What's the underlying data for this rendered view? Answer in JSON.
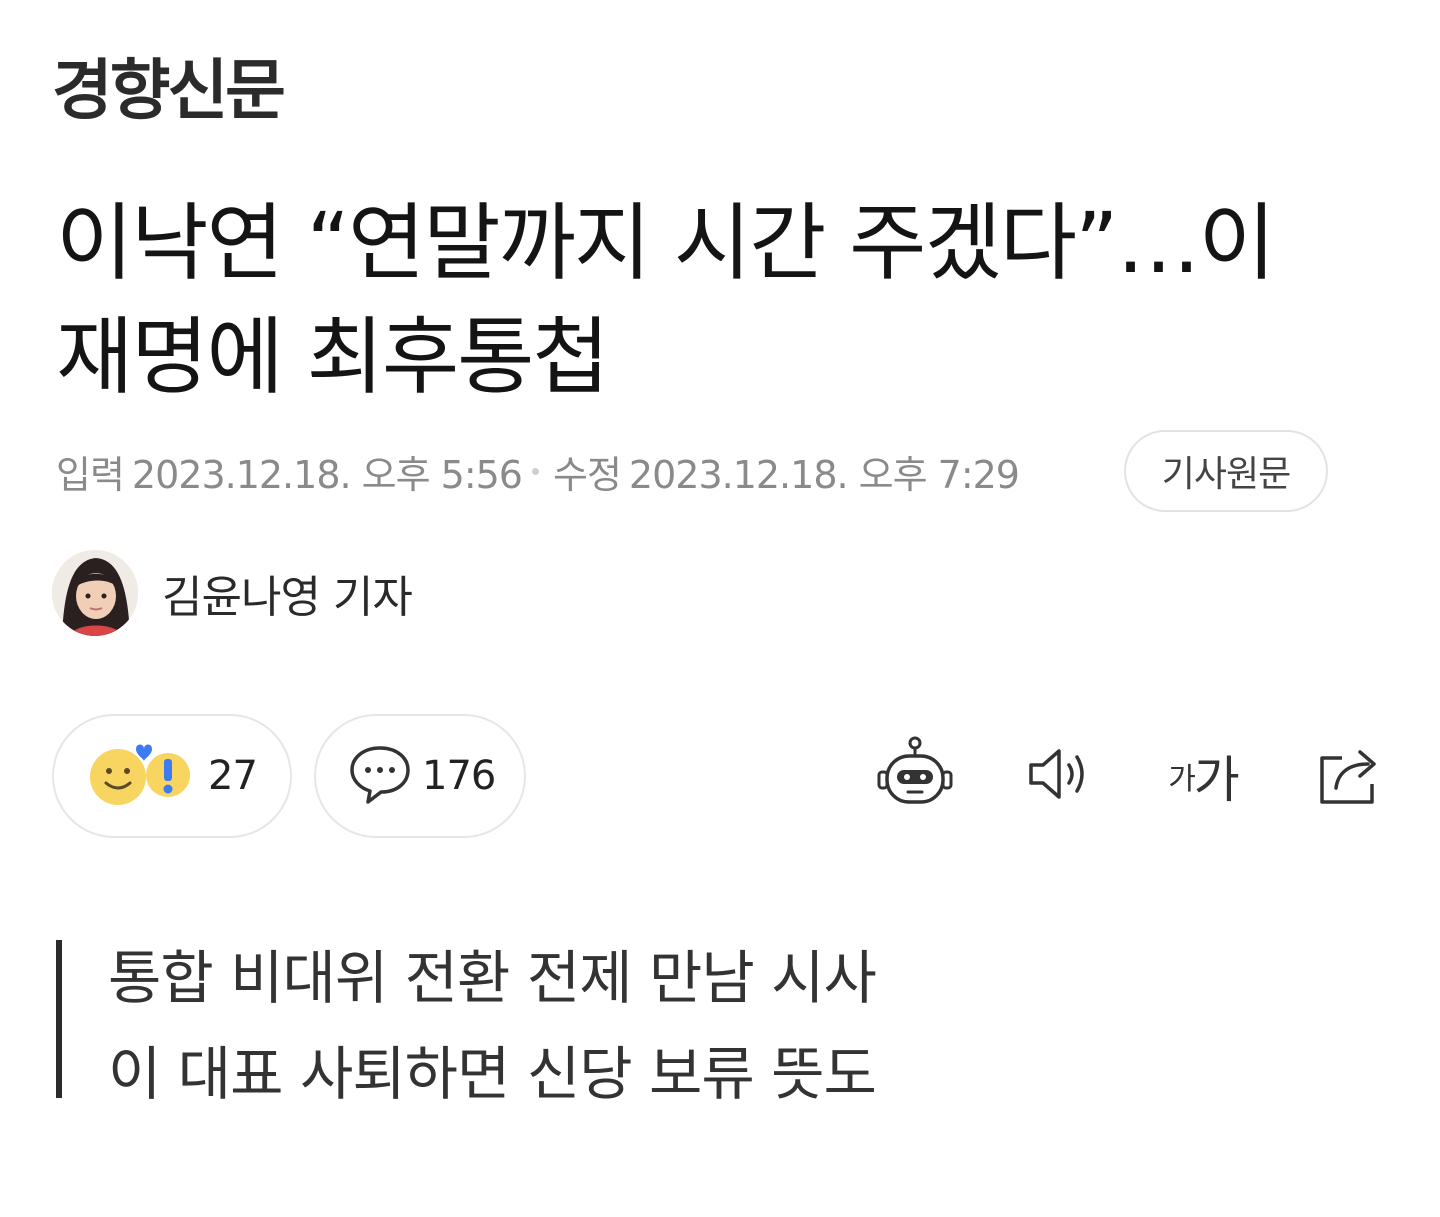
{
  "publisher": {
    "name": "경향신문"
  },
  "headline": {
    "line1": "이낙연 “연말까지 시간 주겠다”…이",
    "line2": "재명에 최후통첩"
  },
  "meta": {
    "published_label": "입력",
    "published": "2023.12.18. 오후 5:56",
    "modified_label": "수정",
    "modified": "2023.12.18. 오후 7:29",
    "original_button": "기사원문"
  },
  "author": {
    "name": "김윤나영 기자"
  },
  "reactions": {
    "count": "27",
    "icon": "emotion-emoji-icon"
  },
  "comments": {
    "count": "176",
    "icon": "comment-bubble-icon"
  },
  "tools": {
    "summary_bot_icon": "robot-icon",
    "tts_icon": "speaker-icon",
    "font_size_small": "가",
    "font_size_large": "가",
    "share_icon": "share-icon"
  },
  "summary": {
    "line1": "통합 비대위 전환 전제 만남 시사",
    "line2": "이 대표 사퇴하면 신당 보류 뜻도"
  },
  "colors": {
    "text": "#141414",
    "meta": "#8a8a8a",
    "border": "#e6e6e6",
    "emoji_yellow": "#f7d560",
    "emoji_blue": "#3d7bf2"
  }
}
